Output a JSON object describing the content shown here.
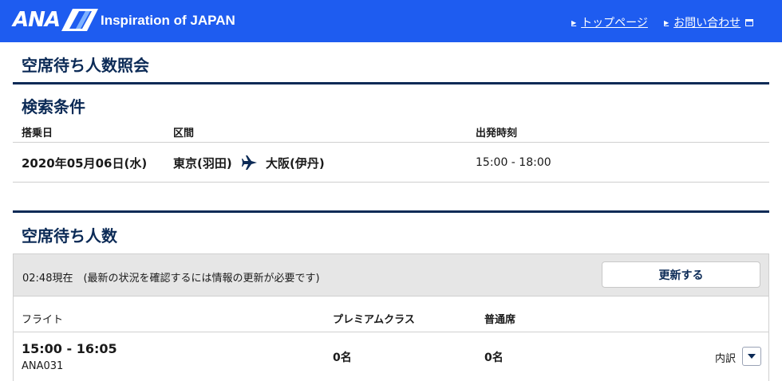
{
  "header": {
    "logo_text": "ANA",
    "tagline": "Inspiration of JAPAN",
    "links": [
      {
        "label": "トップページ"
      },
      {
        "label": "お問い合わせ"
      }
    ]
  },
  "page_title": "空席待ち人数照会",
  "search": {
    "title": "検索条件",
    "columns": {
      "date": "搭乗日",
      "route": "区間",
      "departure_time": "出発時刻"
    },
    "date": "2020年05月06日(水)",
    "origin": "東京(羽田)",
    "destination": "大阪(伊丹)",
    "time_range": "15:00 - 18:00"
  },
  "waitlist": {
    "title": "空席待ち人数",
    "status_text": "02:48現在　(最新の状況を確認するには情報の更新が必要です)",
    "refresh_label": "更新する",
    "columns": {
      "flight": "フライト",
      "premium": "プレミアムクラス",
      "economy": "普通席"
    },
    "rows": [
      {
        "time": "15:00 - 16:05",
        "flight_no": "ANA031",
        "premium": "0名",
        "economy": "0名",
        "breakdown_label": "内訳"
      }
    ]
  },
  "colors": {
    "header_bg": "#1e5cf0",
    "navy": "#0b2a56"
  }
}
